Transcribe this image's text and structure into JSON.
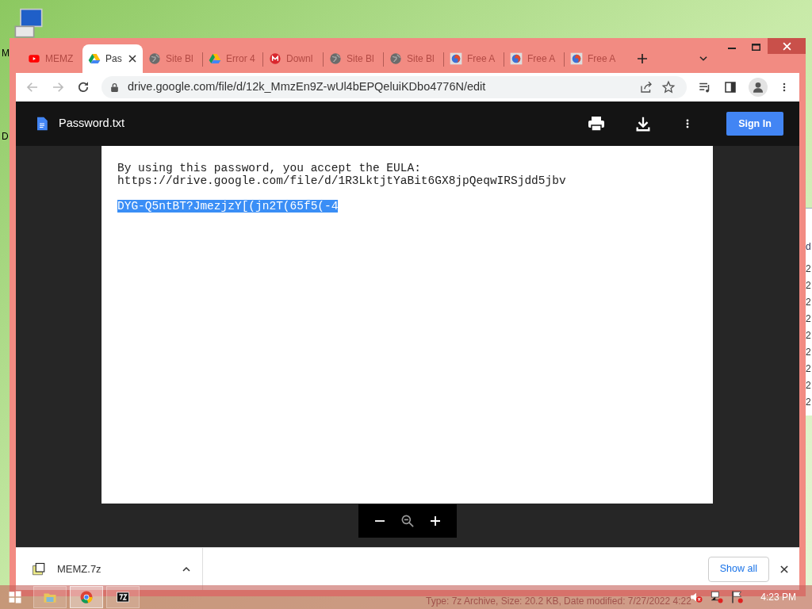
{
  "desktop": {
    "icon_labels": [
      "M",
      "D"
    ]
  },
  "background_window": {
    "column_header": "d",
    "cells": [
      "2",
      "2",
      "2",
      "2",
      "2",
      "2",
      "2",
      "2",
      "2"
    ],
    "status_text": "Type: 7z Archive, Size: 20.2 KB, Date modified: 7/27/2022 4:22"
  },
  "browser": {
    "tabs": [
      {
        "title": "MEMZ",
        "kind": "youtube",
        "selected": false
      },
      {
        "title": "Pas",
        "kind": "drive",
        "selected": true
      },
      {
        "title": "Site Bl",
        "kind": "globe",
        "selected": false
      },
      {
        "title": "Error 4",
        "kind": "drive",
        "selected": false
      },
      {
        "title": "Downl",
        "kind": "mega",
        "selected": false
      },
      {
        "title": "Site Bl",
        "kind": "globe",
        "selected": false
      },
      {
        "title": "Site Bl",
        "kind": "globe",
        "selected": false
      },
      {
        "title": "Free A",
        "kind": "firefox",
        "selected": false
      },
      {
        "title": "Free A",
        "kind": "firefox",
        "selected": false
      },
      {
        "title": "Free A",
        "kind": "firefox",
        "selected": false
      }
    ],
    "address": "drive.google.com/file/d/12k_MmzEn9Z-wUl4bEPQeluiKDbo4776N/edit",
    "viewer": {
      "file_name": "Password.txt",
      "sign_in": "Sign In",
      "lines": [
        {
          "text": "By using this password, you accept the EULA:",
          "selected": false
        },
        {
          "text": "https://drive.google.com/file/d/1R3LktjtYaBit6GX8jpQeqwIRSjdd5jbv",
          "selected": false
        },
        {
          "text": "DYG-Q5ntBT?JmezjzY[(jn2T(65f5(-4",
          "selected": true
        }
      ]
    },
    "downloads": {
      "file": "MEMZ.7z",
      "show_all": "Show all"
    }
  },
  "taskbar": {
    "apps": [
      {
        "kind": "explorer",
        "selected": false
      },
      {
        "kind": "chrome",
        "selected": true
      },
      {
        "kind": "archiver",
        "selected": false
      }
    ],
    "clock": "4:23 PM"
  }
}
